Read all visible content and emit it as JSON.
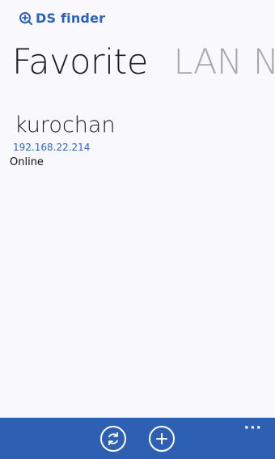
{
  "app": {
    "title": "DS finder"
  },
  "pivot": {
    "tabs": [
      {
        "label": "Favorite"
      },
      {
        "label": "LAN N"
      }
    ]
  },
  "device": {
    "name": "kurochan",
    "ip": "192.168.22.214",
    "status": "Online"
  },
  "appbar": {
    "buttons": [
      {
        "icon": "sync-icon"
      },
      {
        "icon": "add-icon"
      }
    ],
    "more_label": "···"
  },
  "colors": {
    "accent": "#2d5fb3",
    "link": "#2d67bd",
    "background": "#f8f8fd"
  }
}
